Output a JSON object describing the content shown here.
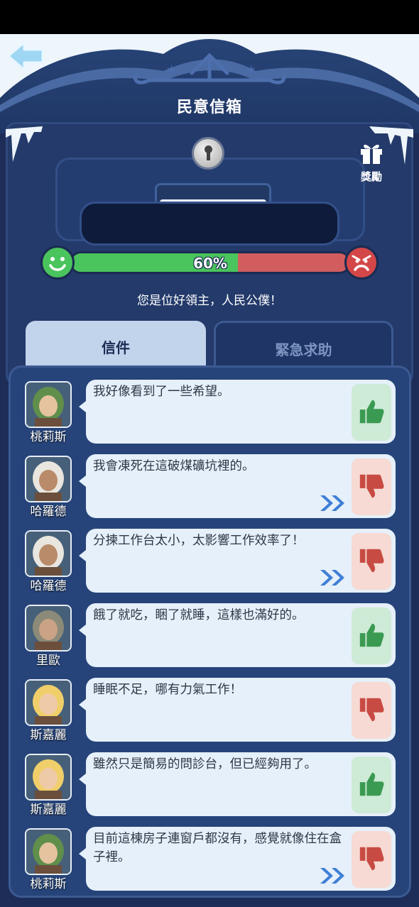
{
  "header": {
    "title": "民意信箱",
    "back_icon": "back-arrow-icon"
  },
  "mailbox": {
    "reward_label": "獎勵",
    "reward_icon": "gift-icon",
    "lock_icon": "keyhole-lock-icon"
  },
  "approval": {
    "percent": 60,
    "percent_label": "60%",
    "status_text": "您是位好領主，人民公僕！"
  },
  "tabs": [
    {
      "label": "信件",
      "active": true
    },
    {
      "label": "緊急求助",
      "active": false
    }
  ],
  "colors": {
    "approve": "#4ac45c",
    "disapprove": "#d15d5e",
    "panel": "#26447a"
  },
  "letters": [
    {
      "name": "桃莉斯",
      "text": "我好像看到了一些希望。",
      "vote": "thumbs-up-icon",
      "has_more": false
    },
    {
      "name": "哈羅德",
      "text": "我會凍死在這破煤礦坑裡的。",
      "vote": "thumbs-down-icon",
      "has_more": true
    },
    {
      "name": "哈羅德",
      "text": "分揀工作台太小，太影響工作效率了！",
      "vote": "thumbs-down-icon",
      "has_more": true
    },
    {
      "name": "里歐",
      "text": "餓了就吃，睏了就睡，這樣也滿好的。",
      "vote": "thumbs-up-icon",
      "has_more": false
    },
    {
      "name": "斯嘉麗",
      "text": "睡眠不足，哪有力氣工作！",
      "vote": "thumbs-down-icon",
      "has_more": false
    },
    {
      "name": "斯嘉麗",
      "text": "雖然只是簡易的問診台，但已經夠用了。",
      "vote": "thumbs-up-icon",
      "has_more": false
    },
    {
      "name": "桃莉斯",
      "text": "目前這棟房子連窗戶都沒有，感覺就像住在盒子裡。",
      "vote": "thumbs-down-icon",
      "has_more": true
    }
  ]
}
